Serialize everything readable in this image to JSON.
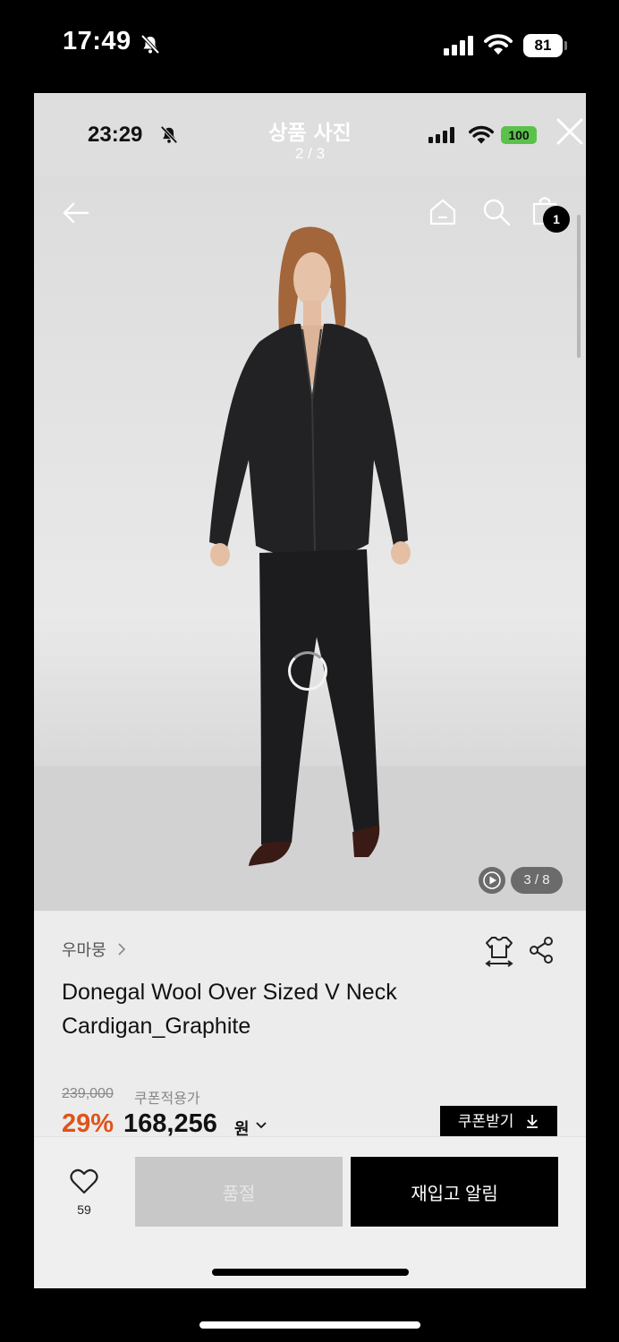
{
  "device_status": {
    "time": "17:49",
    "battery": "81"
  },
  "inner_status": {
    "time": "23:29",
    "battery": "100"
  },
  "viewer": {
    "title": "상품 사진",
    "counter": "2 / 3"
  },
  "nav": {
    "cart_badge": "1"
  },
  "gallery": {
    "counter": "3 / 8"
  },
  "product": {
    "brand": "우마뭉",
    "name": "Donegal Wool Over Sized V Neck Cardigan_Graphite",
    "original_price": "239,000",
    "coupon_price_label": "쿠폰적용가",
    "discount": "29%",
    "price": "168,256",
    "currency": "원",
    "coupon_button": "쿠폰받기"
  },
  "bottom_bar": {
    "like_count": "59",
    "soldout_label": "품절",
    "restock_label": "재입고 알림"
  },
  "colors": {
    "discount": "#e0531b",
    "battery_green": "#5ac24a",
    "primary_button": "#000000"
  }
}
